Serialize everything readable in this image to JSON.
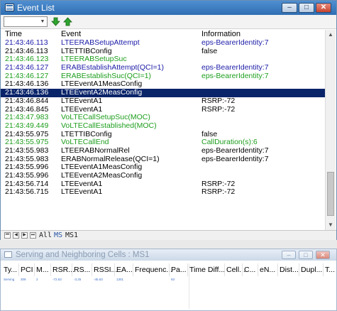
{
  "event_window": {
    "title": "Event List",
    "controls": {
      "minimize": "–",
      "maximize": "□",
      "close": "✕"
    },
    "toolbar": {
      "filter_value": "",
      "up_icon": "green-up-arrow-icon",
      "down_icon": "green-down-arrow-icon"
    },
    "columns": {
      "time": "Time",
      "event": "Event",
      "info": "Information"
    },
    "rows": [
      {
        "time": "21:43:46.113",
        "event": "LTEERABSetupAttempt",
        "info": "eps-BearerIdentity:7",
        "color": "blue"
      },
      {
        "time": "21:43:46.113",
        "event": "LTETTIBConfig",
        "info": "false",
        "color": "black"
      },
      {
        "time": "21:43:46.123",
        "event": "LTEERABSetupSuc",
        "info": "",
        "color": "green"
      },
      {
        "time": "21:43:46.127",
        "event": "ERABEstablishAttempt(QCI=1)",
        "info": "eps-BearerIdentity:7",
        "color": "blue"
      },
      {
        "time": "21:43:46.127",
        "event": "ERABEstablishSuc(QCI=1)",
        "info": "eps-BearerIdentity:7",
        "color": "green"
      },
      {
        "time": "21:43:46.136",
        "event": "LTEEventA1MeasConfig",
        "info": "",
        "color": "black"
      },
      {
        "time": "21:43:46.136",
        "event": "LTEEventA2MeasConfig",
        "info": "",
        "color": "selected"
      },
      {
        "time": "21:43:46.844",
        "event": "LTEEventA1",
        "info": "RSRP:-72",
        "color": "black"
      },
      {
        "time": "21:43:46.845",
        "event": "LTEEventA1",
        "info": "RSRP:-72",
        "color": "black"
      },
      {
        "time": "21:43:47.983",
        "event": "VoLTECallSetupSuc(MOC)",
        "info": "",
        "color": "green"
      },
      {
        "time": "21:43:49.449",
        "event": "VoLTECallEstablished(MOC)",
        "info": "",
        "color": "green"
      },
      {
        "time": "21:43:55.975",
        "event": "LTETTIBConfig",
        "info": "false",
        "color": "black"
      },
      {
        "time": "21:43:55.975",
        "event": "VoLTECallEnd",
        "info": "CallDuration(s):6",
        "color": "green"
      },
      {
        "time": "21:43:55.983",
        "event": "LTEERABNormalRel",
        "info": "eps-BearerIdentity:7",
        "color": "black"
      },
      {
        "time": "21:43:55.983",
        "event": "ERABNormalRelease(QCI=1)",
        "info": "eps-BearerIdentity:7",
        "color": "black"
      },
      {
        "time": "21:43:55.996",
        "event": "LTEEventA1MeasConfig",
        "info": "",
        "color": "black"
      },
      {
        "time": "21:43:55.996",
        "event": "LTEEventA2MeasConfig",
        "info": "",
        "color": "black"
      },
      {
        "time": "21:43:56.714",
        "event": "LTEEventA1",
        "info": "RSRP:-72",
        "color": "black"
      },
      {
        "time": "21:43:56.715",
        "event": "LTEEventA1",
        "info": "RSRP:-72",
        "color": "black"
      }
    ],
    "tabs": [
      {
        "label": "All",
        "active": false
      },
      {
        "label": "MS",
        "active": true
      },
      {
        "label": "MS1",
        "active": false
      }
    ],
    "tab_nav": [
      "⏮",
      "◀",
      "▶",
      "⏭"
    ]
  },
  "cells_window": {
    "title": "Serving and Neighboring Cells : MS1",
    "controls": {
      "minimize": "–",
      "maximize": "□",
      "close": "✕"
    },
    "columns": [
      "Ty...",
      "PCI",
      "M...",
      "RSR...",
      "RS...",
      "RSSI...",
      "EA...",
      "Frequenc...",
      "Pa...",
      "Time Diff...",
      "Cell...",
      "C...",
      "eN...",
      "Dist...",
      "Dupl...",
      "T..."
    ],
    "row": [
      "Serving",
      "309",
      "2",
      "-72.63",
      "-3.25",
      "-45.63",
      "1301",
      "",
      "93",
      "",
      "",
      "",
      "",
      "",
      "",
      ""
    ]
  },
  "colors": {
    "green": "#1d9e1d",
    "blue": "#1b1ba8",
    "selected_bg": "#0a246a",
    "title_bar": "#3d7fc3"
  }
}
